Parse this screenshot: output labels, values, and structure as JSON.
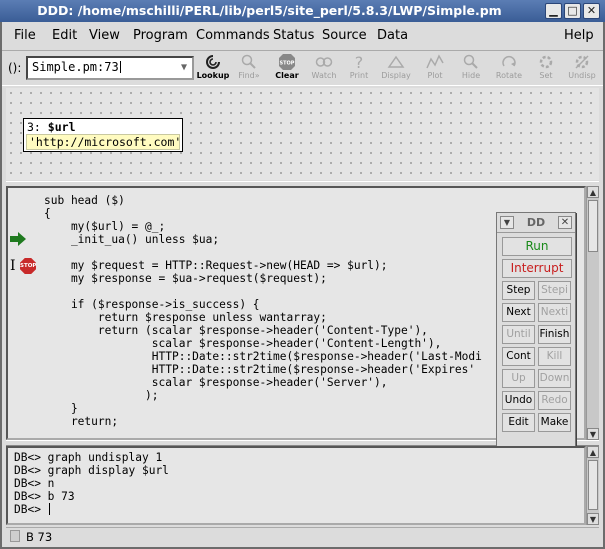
{
  "window": {
    "title": "DDD: /home/mschilli/PERL/lib/perl5/site_perl/5.8.3/LWP/Simple.pm",
    "minimize": "▁",
    "maximize": "□",
    "close": "✕"
  },
  "menubar": {
    "file": "File",
    "edit": "Edit",
    "view": "View",
    "program": "Program",
    "commands": "Commands",
    "status": "Status",
    "source": "Source",
    "data": "Data",
    "help": "Help"
  },
  "toolbar": {
    "arg_prefix": "():",
    "arg_value": "Simple.pm:73",
    "buttons": [
      {
        "label": "Lookup",
        "icon": "lookup-icon",
        "enabled": true
      },
      {
        "label": "Find»",
        "icon": "find-icon",
        "enabled": false
      },
      {
        "label": "Clear",
        "icon": "stop-icon",
        "enabled": true
      },
      {
        "label": "Watch",
        "icon": "watch-icon",
        "enabled": false
      },
      {
        "label": "Print",
        "icon": "print-icon",
        "enabled": false
      },
      {
        "label": "Display",
        "icon": "display-icon",
        "enabled": false
      },
      {
        "label": "Plot",
        "icon": "plot-icon",
        "enabled": false
      },
      {
        "label": "Hide",
        "icon": "hide-icon",
        "enabled": false
      },
      {
        "label": "Rotate",
        "icon": "rotate-icon",
        "enabled": false
      },
      {
        "label": "Set",
        "icon": "set-icon",
        "enabled": false
      },
      {
        "label": "Undisp",
        "icon": "undisp-icon",
        "enabled": false
      }
    ]
  },
  "data_display": {
    "item_number": "3:",
    "item_name": "$url",
    "item_value": "'http://microsoft.com'"
  },
  "source": {
    "lines": [
      "sub head ($)",
      "{",
      "    my($url) = @_;",
      "    _init_ua() unless $ua;",
      "",
      "    my $request = HTTP::Request->new(HEAD => $url);",
      "    my $response = $ua->request($request);",
      "",
      "    if ($response->is_success) {",
      "        return $response unless wantarray;",
      "        return (scalar $response->header('Content-Type'),",
      "                scalar $response->header('Content-Length'),",
      "                HTTP::Date::str2time($response->header('Last-Modi",
      "                HTTP::Date::str2time($response->header('Expires'",
      "                scalar $response->header('Server'),",
      "               );",
      "    }",
      "    return;"
    ],
    "stop_label": "STOP",
    "breakpoint_marker": "I"
  },
  "dd_panel": {
    "title": "DD",
    "run": "Run",
    "interrupt": "Interrupt",
    "step": "Step",
    "stepi": "Stepi",
    "next": "Next",
    "nexti": "Nexti",
    "until": "Until",
    "finish": "Finish",
    "cont": "Cont",
    "kill": "Kill",
    "up": "Up",
    "down": "Down",
    "undo": "Undo",
    "redo": "Redo",
    "edit": "Edit",
    "make": "Make"
  },
  "console": {
    "lines": [
      "DB<> graph undisplay 1",
      "DB<> graph display $url",
      "DB<> n",
      "DB<> b 73",
      "DB<> "
    ]
  },
  "status": {
    "text": "B 73"
  },
  "colors": {
    "title_bg": "#3a5d96",
    "run_green": "#1a8a1a",
    "interrupt_red": "#c81e1e",
    "stop_red": "#c82a2a",
    "arrow_green": "#1f7a1f",
    "value_bg": "#fffbc0"
  }
}
